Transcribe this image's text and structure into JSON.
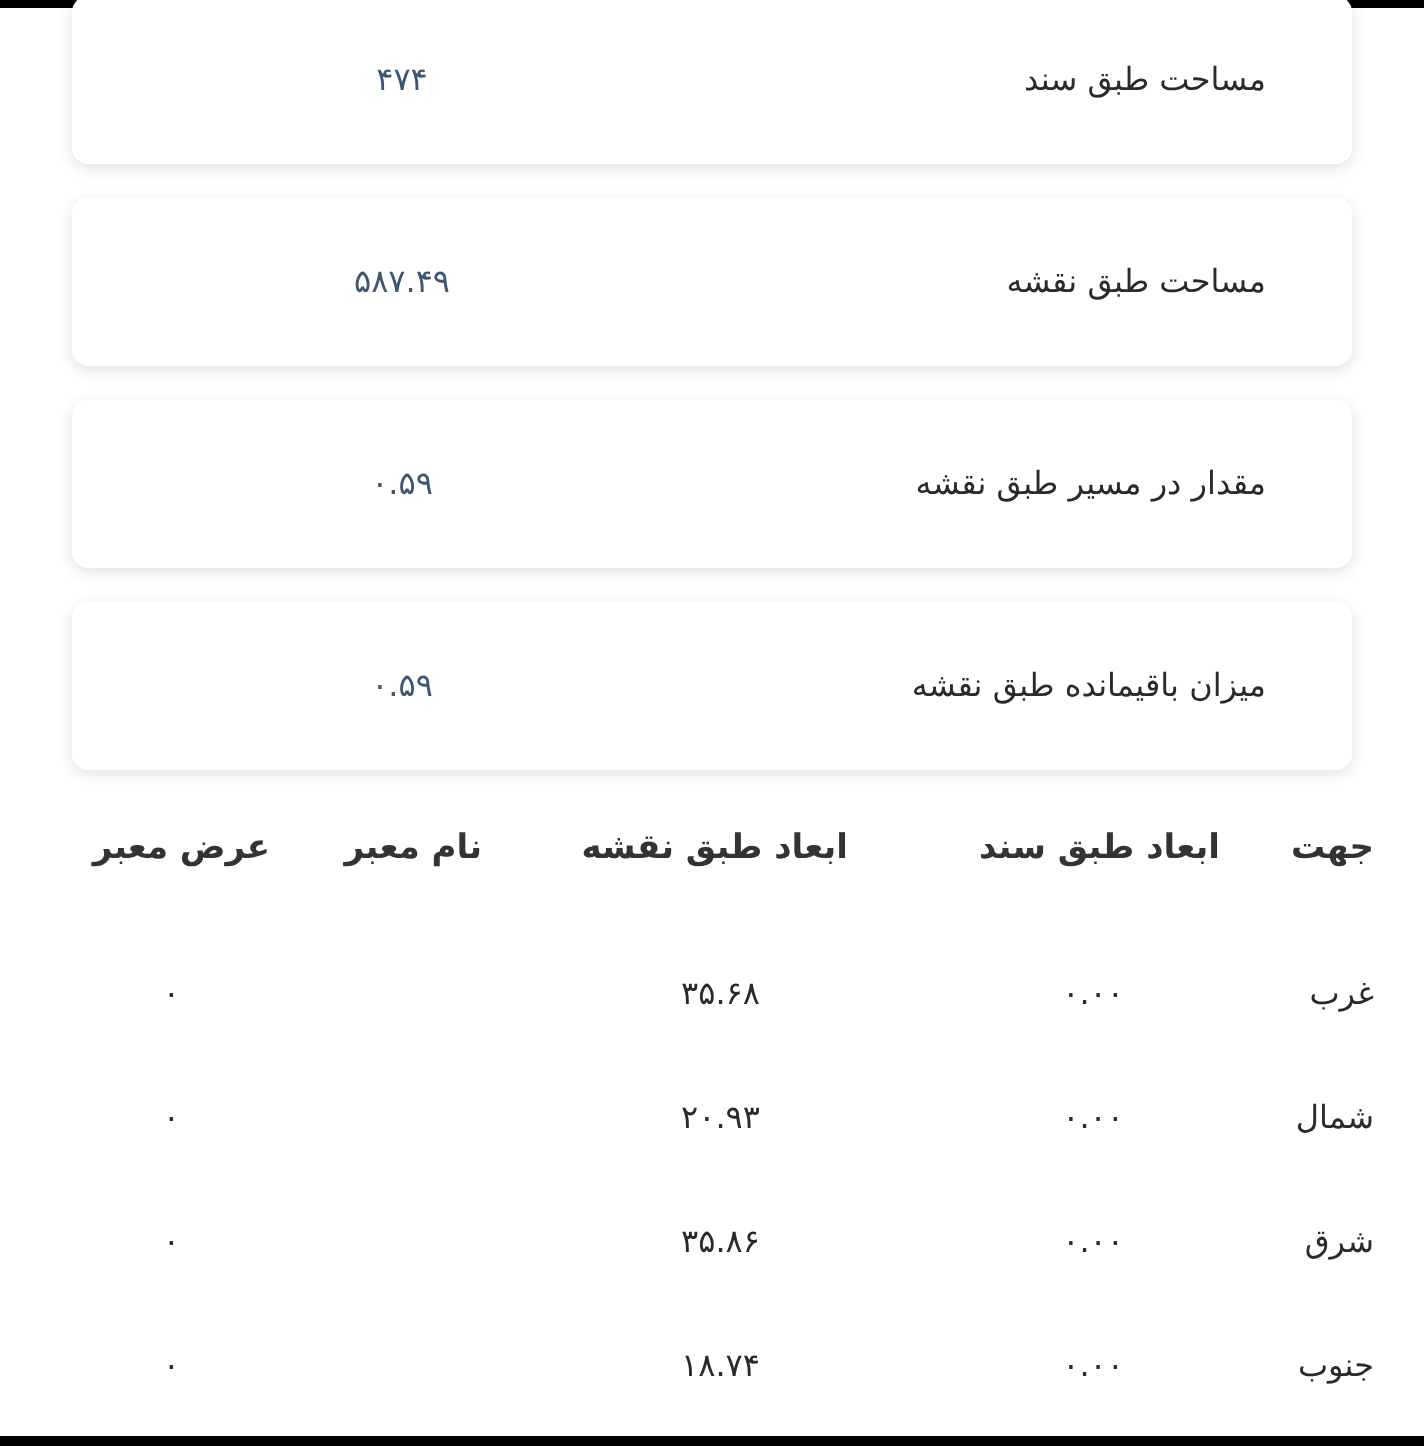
{
  "cards": [
    {
      "label": "مساحت طبق سند",
      "value": "۴۷۴"
    },
    {
      "label": "مساحت طبق نقشه",
      "value": "۵۸۷.۴۹"
    },
    {
      "label": "مقدار در مسیر طبق نقشه",
      "value": "۰.۵۹"
    },
    {
      "label": "میزان باقیمانده طبق نقشه",
      "value": "۰.۵۹"
    }
  ],
  "table": {
    "columns": [
      "جهت",
      "ابعاد طبق سند",
      "ابعاد طبق نقشه",
      "نام معبر",
      "عرض معبر"
    ],
    "rows": [
      [
        "غرب",
        "۰.۰۰",
        "۳۵.۶۸",
        "",
        "۰"
      ],
      [
        "شمال",
        "۰.۰۰",
        "۲۰.۹۳",
        "",
        "۰"
      ],
      [
        "شرق",
        "۰.۰۰",
        "۳۵.۸۶",
        "",
        "۰"
      ],
      [
        "جنوب",
        "۰.۰۰",
        "۱۸.۷۴",
        "",
        "۰"
      ]
    ]
  }
}
